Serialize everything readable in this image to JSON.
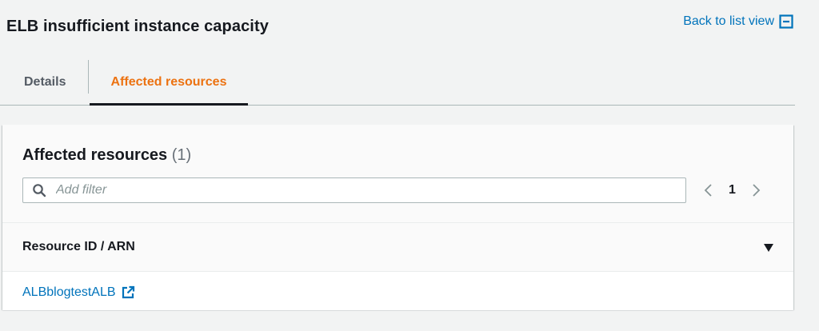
{
  "header": {
    "title": "ELB insufficient instance capacity",
    "back_link_label": "Back to list view",
    "back_link_icon": "collapse-icon"
  },
  "tabs": [
    {
      "label": "Details",
      "active": false
    },
    {
      "label": "Affected resources",
      "active": true
    }
  ],
  "colors": {
    "accent_link": "#0073bb",
    "active_tab": "#ec7211",
    "page_background": "#f2f3f3"
  },
  "resources_panel": {
    "title": "Affected resources",
    "count": "(1)",
    "filter": {
      "placeholder": "Add filter",
      "value": "",
      "icon": "search-icon"
    },
    "pagination": {
      "current_page": "1",
      "prev_icon": "chevron-left-icon",
      "next_icon": "chevron-right-icon"
    },
    "table": {
      "columns": [
        "Resource ID / ARN"
      ],
      "sort_icon": "caret-down-icon",
      "rows": [
        {
          "resource": "ALBblogtestALB",
          "icon": "external-link-icon"
        }
      ]
    }
  }
}
